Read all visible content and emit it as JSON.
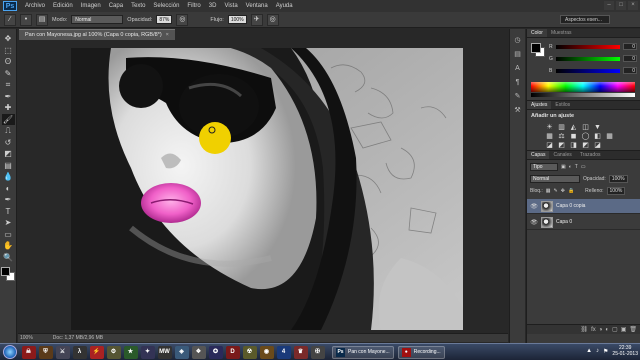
{
  "app": {
    "logo": "Ps"
  },
  "menubar": {
    "items": [
      "Archivo",
      "Edición",
      "Imagen",
      "Capa",
      "Texto",
      "Selección",
      "Filtro",
      "3D",
      "Vista",
      "Ventana",
      "Ayuda"
    ],
    "window_controls": [
      "–",
      "□",
      "×"
    ]
  },
  "options": {
    "mode_label": "Modo:",
    "mode_value": "Normal",
    "opacity_label": "Opacidad:",
    "opacity_value": "87%",
    "flow_label": "Flujo:",
    "flow_value": "100%",
    "workspace": "Aspectos esen..."
  },
  "document": {
    "tab_title": "Pan con Mayonesa.jpg al 100% (Capa 0 copia, RGB/8*)",
    "tab_close": "×",
    "zoom": "100%",
    "doc_info": "Doc: 1,37 MB/2,96 MB"
  },
  "toolbox": {
    "icons": [
      "move-icon",
      "marquee-icon",
      "lasso-icon",
      "quick-select-icon",
      "crop-icon",
      "eyedropper-icon",
      "healing-icon",
      "brush-icon",
      "stamp-icon",
      "history-brush-icon",
      "eraser-icon",
      "gradient-icon",
      "blur-icon",
      "dodge-icon",
      "pen-icon",
      "type-icon",
      "path-select-icon",
      "shape-icon",
      "hand-icon",
      "zoom-icon"
    ],
    "glyphs": [
      "✥",
      "⬚",
      "ʘ",
      "✎",
      "⌗",
      "✒",
      "✚",
      "🖌",
      "⎍",
      "↺",
      "◩",
      "▤",
      "💧",
      "◐",
      "✒",
      "T",
      "➤",
      "▭",
      "✋",
      "🔍"
    ]
  },
  "panels": {
    "color_tabs": [
      "Color",
      "Muestras"
    ],
    "color_sliders": [
      {
        "label": "R",
        "value": "0",
        "gradient": "linear-gradient(to right,#000,#ff0000)"
      },
      {
        "label": "G",
        "value": "0",
        "gradient": "linear-gradient(to right,#000,#00ff00)"
      },
      {
        "label": "B",
        "value": "0",
        "gradient": "linear-gradient(to right,#000,#0000ff)"
      }
    ],
    "adj_tabs": [
      "Ajustes",
      "Estilos"
    ],
    "adj_title": "Añadir un ajuste",
    "adj_row1": [
      "☀",
      "▥",
      "◭",
      "◫",
      "▼"
    ],
    "adj_row2": [
      "▦",
      "⚖",
      "◼",
      "◯",
      "◧",
      "▦"
    ],
    "adj_row3": [
      "◪",
      "◩",
      "◨",
      "◩",
      "◪"
    ],
    "layers_tabs": [
      "Capas",
      "Canales",
      "Trazados"
    ],
    "filter_label": "Tipo",
    "blend_mode": "Normal",
    "opacity_label": "Opacidad:",
    "opacity_value": "100%",
    "lock_label": "Bloq.:",
    "fill_label": "Relleno:",
    "fill_value": "100%",
    "layers": [
      {
        "name": "Capa 0 copia",
        "selected": true
      },
      {
        "name": "Capa 0",
        "selected": false
      }
    ],
    "footer_icons": [
      "⛓",
      "fx",
      "◑",
      "◐",
      "▢",
      "▣",
      "🗑"
    ]
  },
  "taskbar": {
    "apps": [
      {
        "name": "skull-icon",
        "glyph": "☠",
        "color": "#8b1a1a"
      },
      {
        "name": "shield-icon",
        "glyph": "⛨",
        "color": "#5a3a1a"
      },
      {
        "name": "game-icon",
        "glyph": "⚔",
        "color": "#445"
      },
      {
        "name": "half-life-icon",
        "glyph": "λ",
        "color": "#333"
      },
      {
        "name": "flash-icon",
        "glyph": "⚡",
        "color": "#a22"
      },
      {
        "name": "game2-icon",
        "glyph": "⚙",
        "color": "#553"
      },
      {
        "name": "game3-icon",
        "glyph": "★",
        "color": "#2a5a2a"
      },
      {
        "name": "game4-icon",
        "glyph": "✦",
        "color": "#335"
      },
      {
        "name": "mw-icon",
        "glyph": "MW",
        "color": "#333"
      },
      {
        "name": "game5-icon",
        "glyph": "◈",
        "color": "#3a5a7a"
      },
      {
        "name": "game6-icon",
        "glyph": "❖",
        "color": "#555"
      },
      {
        "name": "game7-icon",
        "glyph": "✪",
        "color": "#2a2a5a"
      },
      {
        "name": "dota-icon",
        "glyph": "D",
        "color": "#7a1a1a"
      },
      {
        "name": "game8-icon",
        "glyph": "☢",
        "color": "#5a5a2a"
      },
      {
        "name": "eye-game-icon",
        "glyph": "◉",
        "color": "#6a4a1a"
      },
      {
        "name": "four-icon",
        "glyph": "4",
        "color": "#1a3a7a"
      },
      {
        "name": "game9-icon",
        "glyph": "♛",
        "color": "#7a2a2a"
      },
      {
        "name": "game10-icon",
        "glyph": "✠",
        "color": "#444"
      }
    ],
    "windows": [
      {
        "name": "photoshop-task",
        "icon": "Ps",
        "icon_color": "#0a2a4a",
        "label": "Pan con Mayone..."
      },
      {
        "name": "recording-task",
        "icon": "●",
        "icon_color": "#a01010",
        "label": "Recording..."
      }
    ],
    "tray_icons": [
      "▲",
      "♪",
      "⚑"
    ],
    "time": "22:39",
    "date": "25-01-2013"
  }
}
